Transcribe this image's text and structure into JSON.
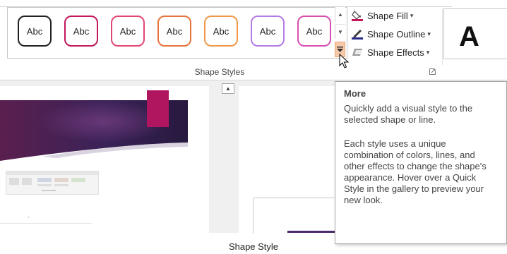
{
  "ribbon": {
    "gallery_swatches": [
      {
        "label": "Abc",
        "border": "#222222"
      },
      {
        "label": "Abc",
        "border": "#c2185b"
      },
      {
        "label": "Abc",
        "border": "#e04873"
      },
      {
        "label": "Abc",
        "border": "#e5743c"
      },
      {
        "label": "Abc",
        "border": "#f0984a"
      },
      {
        "label": "Abc",
        "border": "#b47be8"
      },
      {
        "label": "Abc",
        "border": "#d94fb0"
      }
    ],
    "shape_fill_label": "Shape Fill",
    "shape_outline_label": "Shape Outline",
    "shape_effects_label": "Shape Effects",
    "wordart_letter": "A",
    "group_label": "Shape Styles"
  },
  "tooltip": {
    "title": "More",
    "line1": "Quickly add a visual style to the selected shape or line.",
    "line2": "Each style uses a unique combination of colors, lines, and other effects to change the shape's appearance. Hover over a Quick Style in the gallery to preview your new look."
  },
  "caption": "Shape Style",
  "colors": {
    "accent_more_button": "#f7c9a8",
    "slide_accent": "#b0155f",
    "banner_purple": "#4b2a6b"
  }
}
